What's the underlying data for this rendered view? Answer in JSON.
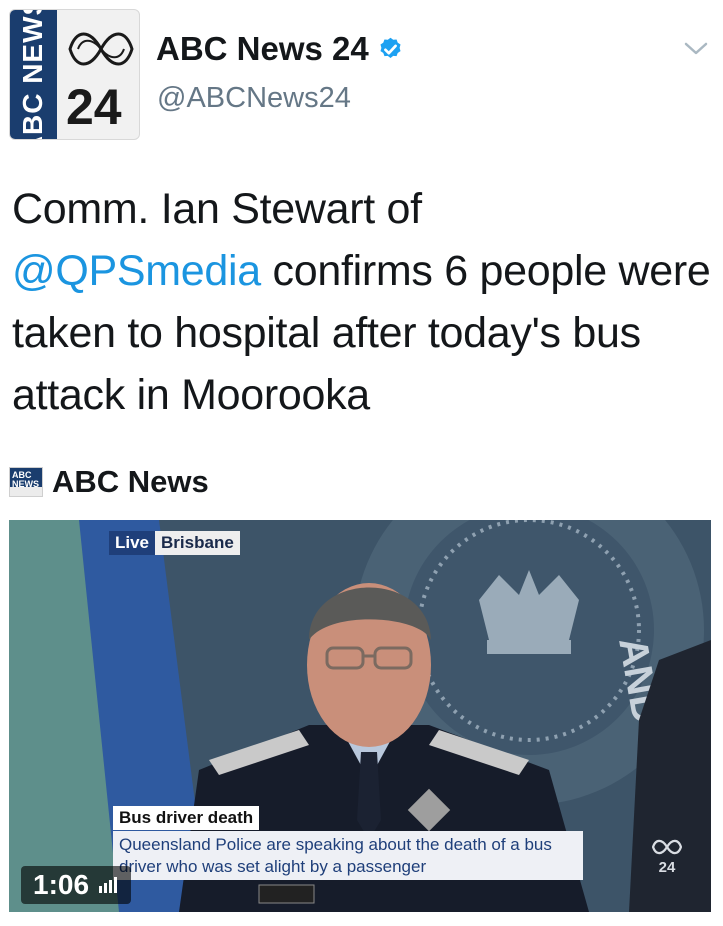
{
  "account": {
    "avatar_text": "ABC NEWS",
    "avatar_number": "24",
    "display_name": "ABC News 24",
    "handle": "@ABCNews24"
  },
  "tweet": {
    "text_1": "Comm. Ian Stewart of",
    "mention": "@QPSmedia",
    "text_2": " confirms 6 people were taken to hospital after today's bus attack in Moorooka"
  },
  "card": {
    "mini_logo_text": "ABC NEWS",
    "title": "ABC News"
  },
  "video": {
    "live_label": "Live",
    "city_label": "Brisbane",
    "headline": "Bus driver death",
    "caption": "Queensland Police are speaking about the death of a bus driver who was set alight by a passenger",
    "duration": "1:06",
    "channel_bug": "24"
  },
  "colors": {
    "link": "#1b95e0",
    "verified": "#1da1f2",
    "abc_blue": "#1a3d6e",
    "handle_gray": "#657786"
  }
}
